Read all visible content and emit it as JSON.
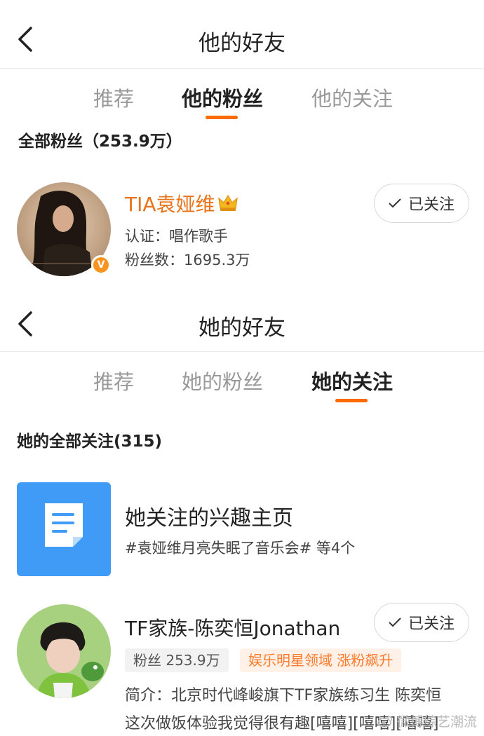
{
  "top": {
    "title": "他的好友",
    "tabs": [
      "推荐",
      "他的粉丝",
      "他的关注"
    ],
    "active_tab": 1,
    "section_label": "全部粉丝（253.9万）",
    "user": {
      "name": "TIA袁娅维",
      "certification": "认证：唱作歌手",
      "fans": "粉丝数：1695.3万",
      "follow_label": "已关注",
      "badge": "V"
    }
  },
  "bottom": {
    "title": "她的好友",
    "tabs": [
      "推荐",
      "她的粉丝",
      "她的关注"
    ],
    "active_tab": 2,
    "section_label": "她的全部关注(315)",
    "interest": {
      "title": "她关注的兴趣主页",
      "subtitle": "#袁娅维月亮失眠了音乐会# 等4个"
    },
    "user": {
      "name": "TF家族-陈奕恒Jonathan",
      "fans_tag": "粉丝 253.9万",
      "highlight_tag": "娱乐明星领域 涨粉飙升",
      "bio_line1": "简介：北京时代峰峻旗下TF家族练习生 陈奕恒",
      "bio_line2": "这次做饭体验我觉得很有趣[嘻嘻][嘻嘻][嘻嘻]",
      "follow_label": "已关注"
    }
  },
  "watermark": "微博综艺潮流",
  "colors": {
    "accent": "#ff6a00",
    "name_orange": "#e8731a",
    "interest_blue": "#3f9bf5",
    "verified": "#f7931e"
  },
  "icons": {
    "back": "chevron-left-icon",
    "check": "check-icon",
    "crown": "crown-icon",
    "document": "document-icon"
  }
}
